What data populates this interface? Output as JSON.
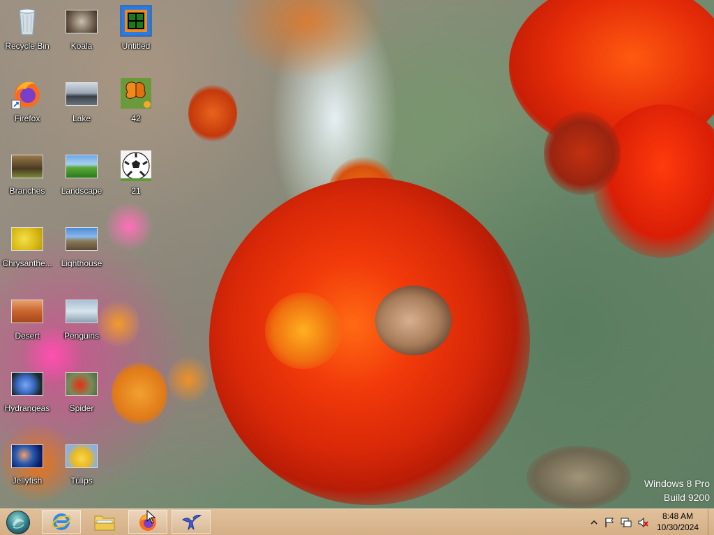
{
  "desktop": {
    "icons": [
      {
        "label": "Recycle Bin",
        "icon": "recycle-bin-icon"
      },
      {
        "label": "Koala",
        "icon": "image-thumbnail-koala"
      },
      {
        "label": "Untitled",
        "icon": "paint-image-icon"
      },
      {
        "label": "Firefox",
        "icon": "firefox-icon"
      },
      {
        "label": "Lake",
        "icon": "image-thumbnail-lake"
      },
      {
        "label": "42",
        "icon": "image-thumbnail-butterfly"
      },
      {
        "label": "Branches",
        "icon": "image-thumbnail-branches"
      },
      {
        "label": "Landscape",
        "icon": "image-thumbnail-landscape"
      },
      {
        "label": "21",
        "icon": "image-thumbnail-soccer-ball"
      },
      {
        "label": "Chrysanthe...",
        "icon": "image-thumbnail-chrysanthemum"
      },
      {
        "label": "Lighthouse",
        "icon": "image-thumbnail-lighthouse"
      },
      {
        "label": "Desert",
        "icon": "image-thumbnail-desert"
      },
      {
        "label": "Penguins",
        "icon": "image-thumbnail-penguins"
      },
      {
        "label": "Hydrangeas",
        "icon": "image-thumbnail-hydrangeas"
      },
      {
        "label": "Spider",
        "icon": "image-thumbnail-spider"
      },
      {
        "label": "Jellyfish",
        "icon": "image-thumbnail-jellyfish"
      },
      {
        "label": "Tulips",
        "icon": "image-thumbnail-tulips"
      }
    ]
  },
  "watermark": {
    "line1": "Windows 8 Pro",
    "line2": "Build 9200"
  },
  "taskbar": {
    "pinned": [
      {
        "name": "internet-explorer",
        "icon": "internet-explorer-icon"
      },
      {
        "name": "file-explorer",
        "icon": "folder-icon"
      },
      {
        "name": "firefox",
        "icon": "firefox-icon"
      },
      {
        "name": "app",
        "icon": "blue-bird-icon"
      }
    ],
    "tray_icons": [
      "show-hidden-icons-chevron",
      "action-center-flag-icon",
      "network-icon",
      "volume-muted-icon"
    ],
    "clock": {
      "time": "8:48 AM",
      "date": "10/30/2024"
    }
  },
  "colors": {
    "taskbar": "#dcb48c",
    "start_orb": "#3a8a94",
    "marigold_red": "#d8280c",
    "marigold_orange": "#f08a1c"
  }
}
